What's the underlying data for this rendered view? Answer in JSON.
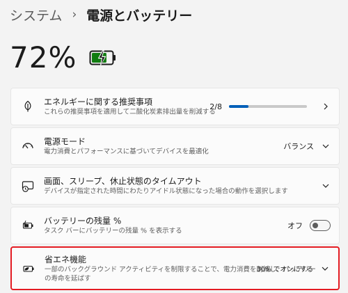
{
  "breadcrumb": {
    "parent": "システム",
    "separator": "›",
    "current": "電源とバッテリー"
  },
  "battery": {
    "percent_text": "72%",
    "level": 0.72,
    "charging": true,
    "icon": "battery-charging-icon",
    "color": "#107c10"
  },
  "cards": {
    "energy": {
      "icon": "leaf-icon",
      "title": "エネルギーに関する推奨事項",
      "subtitle": "これらの推奨事項を適用して二酸化炭素排出量を削減する",
      "progress_text": "2/8",
      "progress_fraction": 0.25
    },
    "power_mode": {
      "icon": "power-mode-gauge-icon",
      "title": "電源モード",
      "subtitle": "電力消費とパフォーマンスに基づいてデバイスを最適化",
      "value": "バランス"
    },
    "screen_sleep": {
      "icon": "screen-sleep-icon",
      "title": "画面、スリープ、休止状態のタイムアウト",
      "subtitle": "デバイスが指定された時間にわたりアイドル状態になった場合の動作を選択します"
    },
    "battery_percent": {
      "icon": "battery-percent-icon",
      "title": "バッテリーの残量 %",
      "subtitle": "タスク バーにバッテリーの残量 % を表示する",
      "toggle_label": "オフ",
      "toggle_on": false
    },
    "energy_saver": {
      "icon": "energy-saver-icon",
      "title": "省エネ機能",
      "subtitle_line1": "一部のバックグラウンド アクティビティを制限することで、電力消費を削減し、バッテリー",
      "subtitle_line2": "の寿命を延ばす",
      "value": "30% でオンにする"
    }
  },
  "colors": {
    "accent": "#005fb8",
    "highlight_border": "#e41c23",
    "battery_green": "#107c10"
  }
}
